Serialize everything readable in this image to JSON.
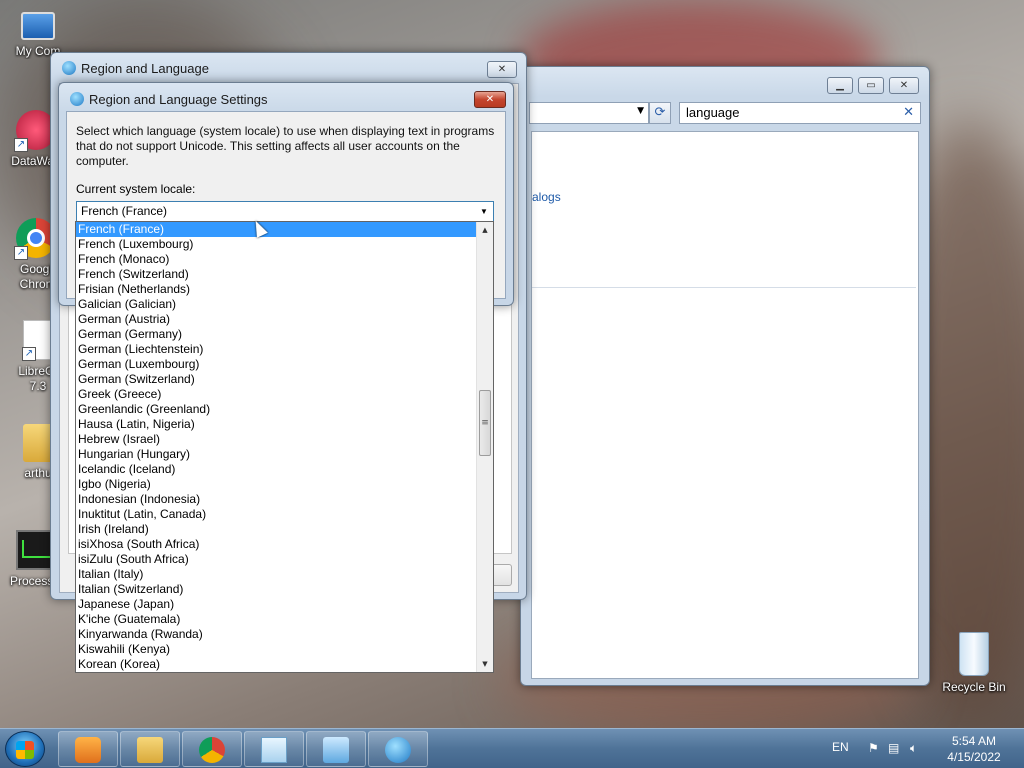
{
  "desktop": {
    "icons": [
      {
        "label": "My Com"
      },
      {
        "label": "DataWag"
      },
      {
        "label": "Googl"
      },
      {
        "label": "Chron"
      },
      {
        "label": "LibreOf"
      },
      {
        "label": "7.3"
      },
      {
        "label": "arthu"
      },
      {
        "label": "ProcessH"
      }
    ],
    "recycle_bin": "Recycle Bin"
  },
  "control_panel": {
    "search_value": "language",
    "link_fragment": "alogs"
  },
  "region_window": {
    "title": "Region and Language"
  },
  "settings_dialog": {
    "title": "Region and Language Settings",
    "description": "Select which language (system locale) to use when displaying text in programs that do not support Unicode. This setting affects all user accounts on the computer.",
    "locale_label": "Current system locale:",
    "selected_locale": "French (France)",
    "locale_options": [
      "French (France)",
      "French (Luxembourg)",
      "French (Monaco)",
      "French (Switzerland)",
      "Frisian (Netherlands)",
      "Galician (Galician)",
      "German (Austria)",
      "German (Germany)",
      "German (Liechtenstein)",
      "German (Luxembourg)",
      "German (Switzerland)",
      "Greek (Greece)",
      "Greenlandic (Greenland)",
      "Hausa (Latin, Nigeria)",
      "Hebrew (Israel)",
      "Hungarian (Hungary)",
      "Icelandic (Iceland)",
      "Igbo (Nigeria)",
      "Indonesian (Indonesia)",
      "Inuktitut (Latin, Canada)",
      "Irish (Ireland)",
      "isiXhosa (South Africa)",
      "isiZulu (South Africa)",
      "Italian (Italy)",
      "Italian (Switzerland)",
      "Japanese (Japan)",
      "K'iche (Guatemala)",
      "Kinyarwanda (Rwanda)",
      "Kiswahili (Kenya)",
      "Korean (Korea)"
    ]
  },
  "taskbar": {
    "language": "EN",
    "time": "5:54 AM",
    "date": "4/15/2022"
  }
}
